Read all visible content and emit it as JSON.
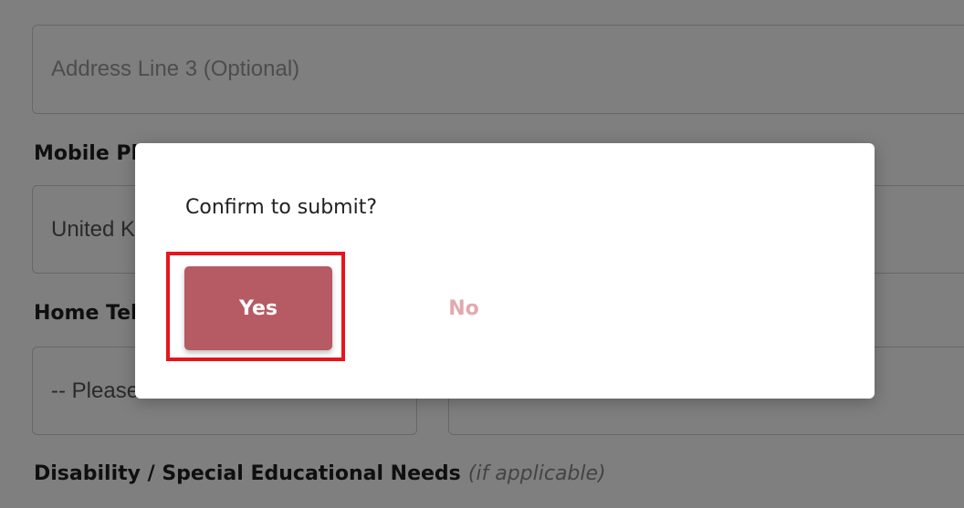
{
  "form": {
    "address_line3_placeholder": "Address Line 3 (Optional)",
    "mobile_label": "Mobile Phone",
    "mobile_country_value": "United Kingdom",
    "home_tel_label": "Home Telephone",
    "home_tel_country_value": "-- Please select --",
    "disability_label": "Disability / Special Educational Needs",
    "disability_hint": "(if applicable)"
  },
  "dialog": {
    "message": "Confirm to submit?",
    "yes_label": "Yes",
    "no_label": "No"
  },
  "colors": {
    "yes_button": "#b65a63",
    "no_text": "#e2a9ae",
    "highlight": "#e8141c"
  }
}
